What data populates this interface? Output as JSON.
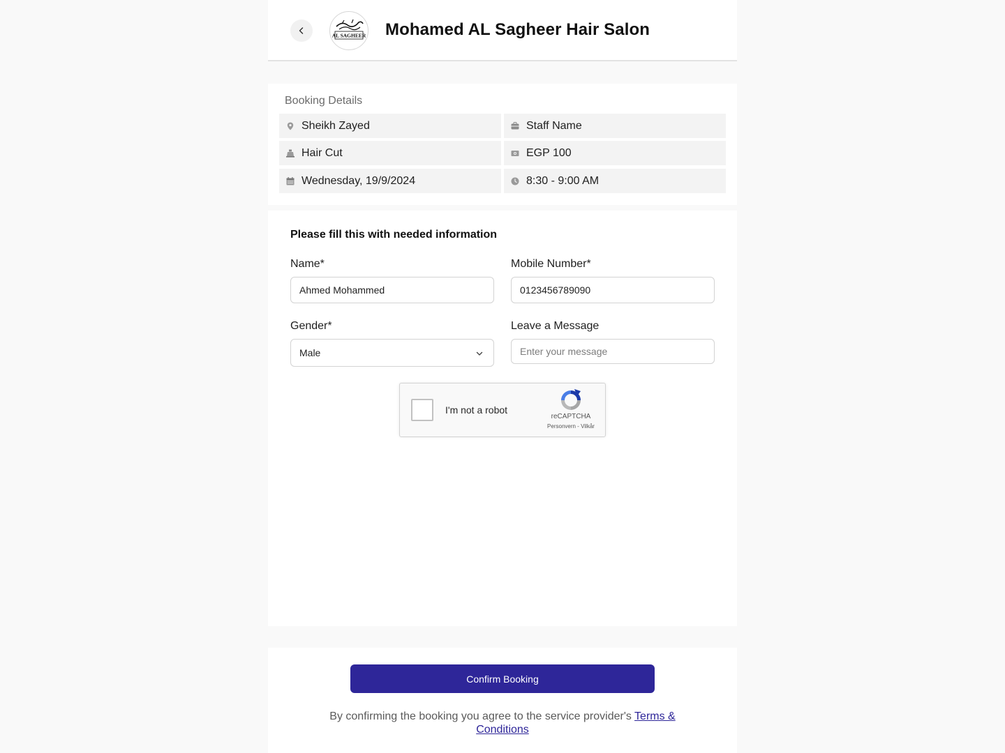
{
  "header": {
    "salon_name": "Mohamed AL Sagheer Hair Salon",
    "logo_text": "AL SAGHEER",
    "back_icon": "chevron-left-icon"
  },
  "booking": {
    "title": "Booking Details",
    "location": {
      "icon": "location-pin-icon",
      "value": "Sheikh Zayed"
    },
    "staff": {
      "icon": "staff-icon",
      "value": "Staff Name"
    },
    "service": {
      "icon": "service-icon",
      "value": "Hair Cut"
    },
    "price": {
      "icon": "money-icon",
      "value": "EGP 100"
    },
    "date": {
      "icon": "calendar-icon",
      "value": "Wednesday, 19/9/2024"
    },
    "time": {
      "icon": "clock-icon",
      "value": "8:30 - 9:00 AM"
    }
  },
  "form": {
    "title": "Please fill this with needed information",
    "name_label": "Name*",
    "name_value": "Ahmed Mohammed",
    "mobile_label": "Mobile Number*",
    "mobile_value": "0123456789090",
    "gender_label": "Gender*",
    "gender_value": "Male",
    "message_label": "Leave a Message",
    "message_placeholder": "Enter your message"
  },
  "captcha": {
    "label": "I'm not a robot",
    "brand": "reCAPTCHA",
    "links": "Personvern - Vilkår"
  },
  "footer": {
    "confirm_label": "Confirm Booking",
    "terms_text": "By confirming the booking you agree to the service provider's",
    "terms_link": "Terms & Conditions"
  },
  "colors": {
    "accent": "#2e2699",
    "background": "#f9f9f9",
    "card": "#ffffff",
    "detail_cell": "#f3f3f3"
  }
}
